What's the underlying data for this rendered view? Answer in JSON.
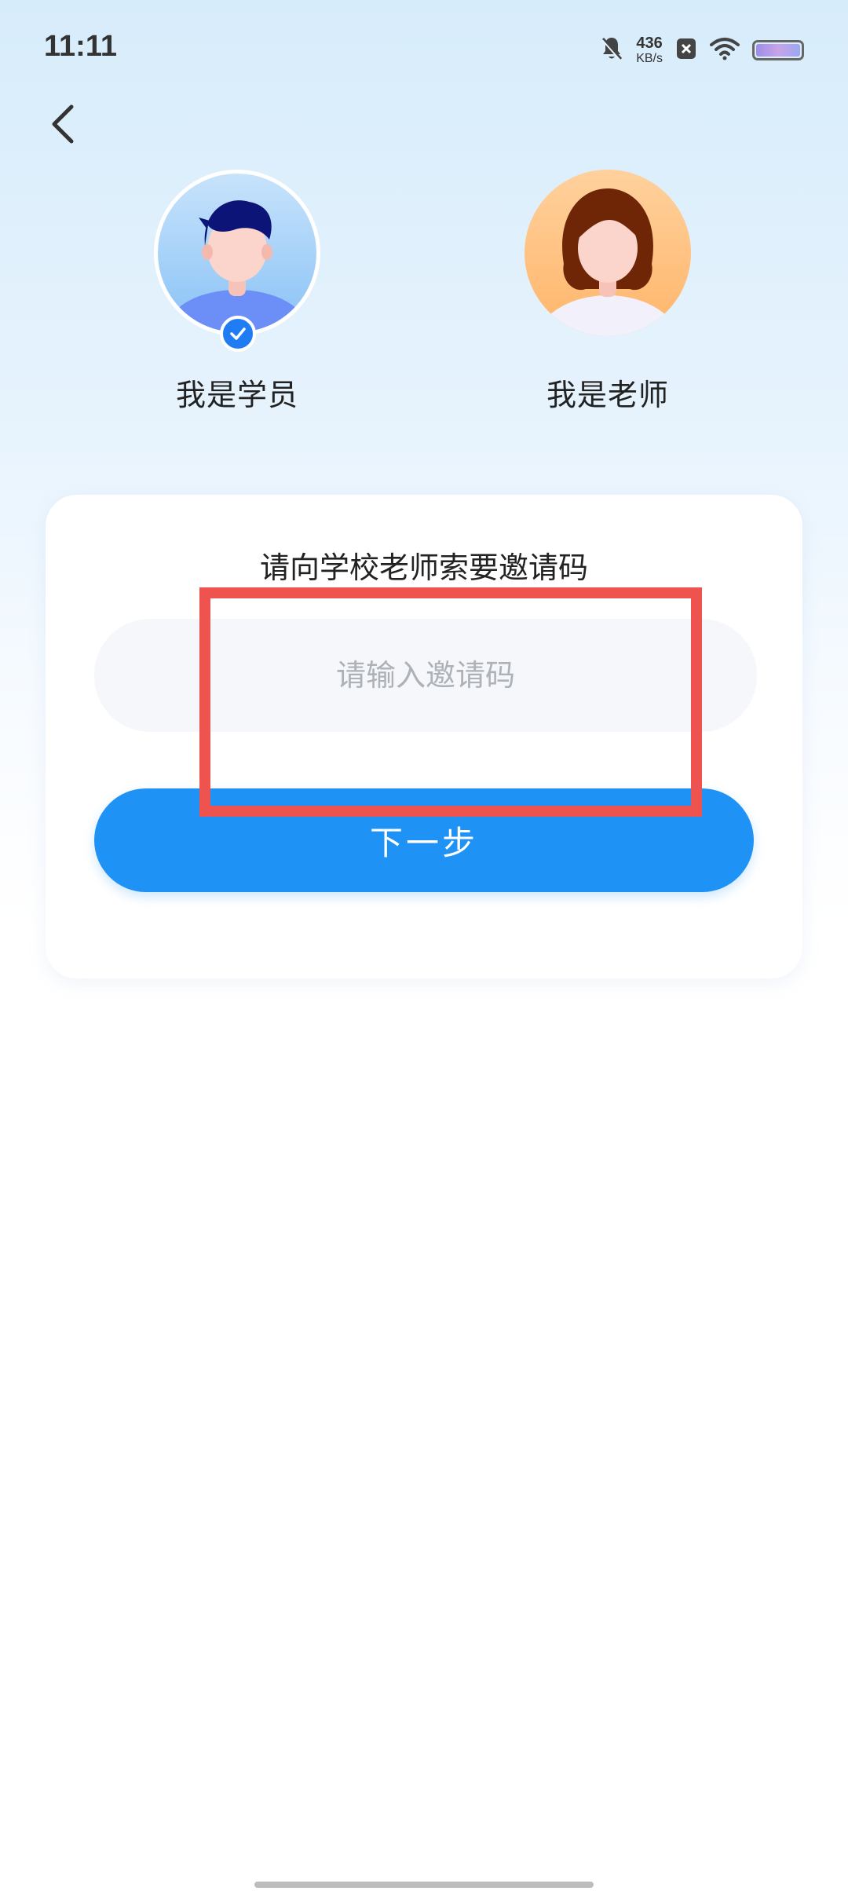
{
  "status_bar": {
    "time": "11:11",
    "net_speed_value": "436",
    "net_speed_unit": "KB/s",
    "icons": [
      "mute-bell-icon",
      "close-box-icon",
      "wifi-icon",
      "battery-icon"
    ]
  },
  "nav": {
    "back_icon": "chevron-left-icon"
  },
  "roles": {
    "student": {
      "label": "我是学员",
      "selected": true
    },
    "teacher": {
      "label": "我是老师",
      "selected": false
    }
  },
  "invite": {
    "title": "请向学校老师索要邀请码",
    "input_value": "",
    "placeholder": "请输入邀请码",
    "next_label": "下一步"
  },
  "colors": {
    "accent": "#1e92f5",
    "check_badge": "#1f7cf3",
    "highlight": "#ef5350",
    "background_top": "#d7ecfb"
  }
}
